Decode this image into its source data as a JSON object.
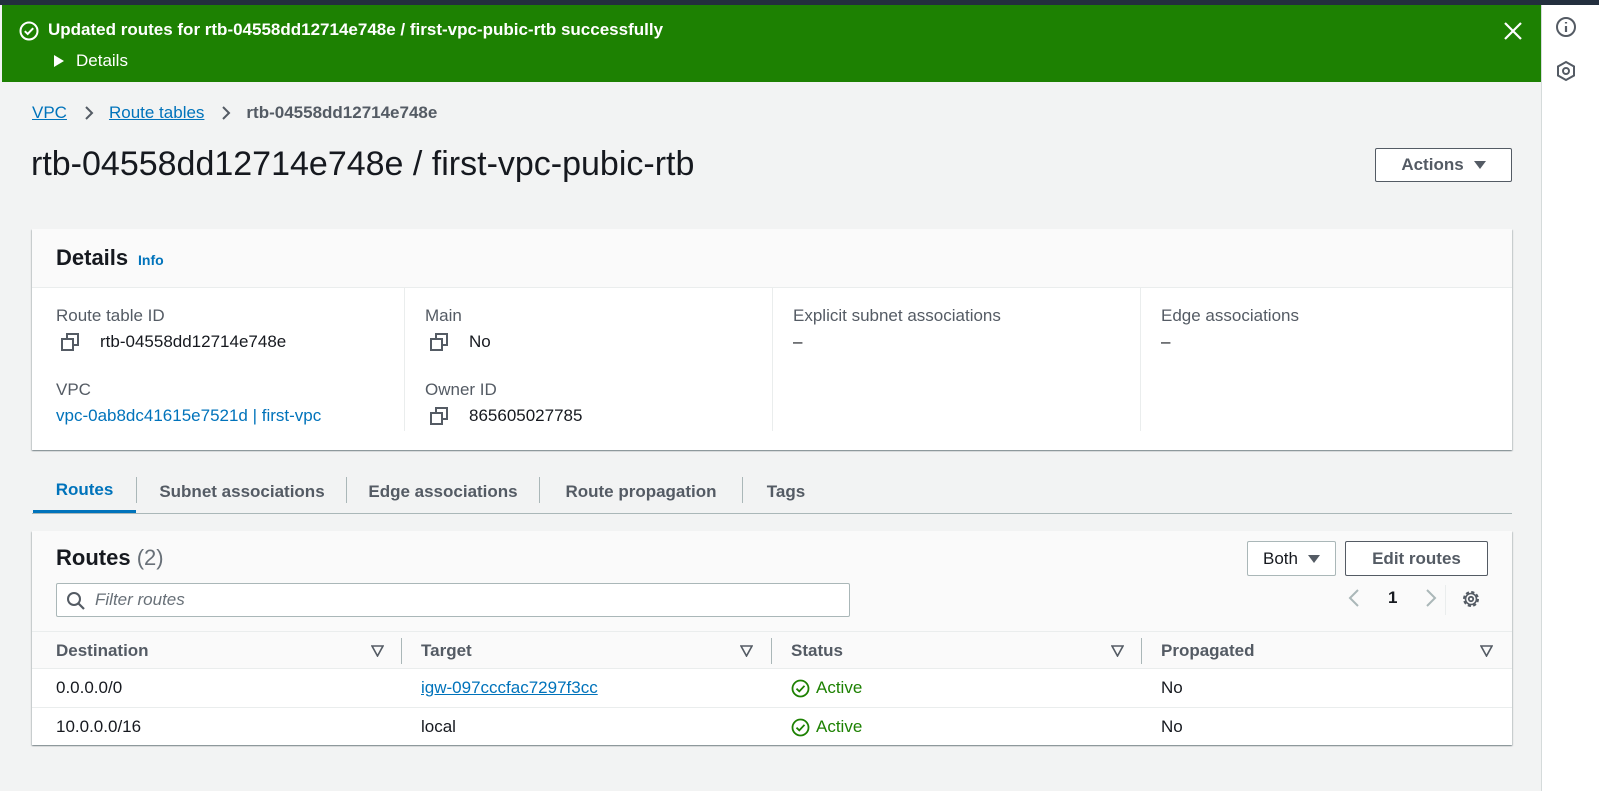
{
  "flash": {
    "message": "Updated routes for rtb-04558dd12714e748e / first-vpc-pubic-rtb successfully",
    "details_label": "Details",
    "color": "#1d8102"
  },
  "breadcrumb": {
    "items": [
      "VPC",
      "Route tables"
    ],
    "current": "rtb-04558dd12714e748e"
  },
  "page": {
    "title": "rtb-04558dd12714e748e / first-vpc-pubic-rtb",
    "actions_label": "Actions"
  },
  "details": {
    "title": "Details",
    "info_label": "Info",
    "route_table_id_label": "Route table ID",
    "route_table_id": "rtb-04558dd12714e748e",
    "main_label": "Main",
    "main": "No",
    "explicit_subnet_label": "Explicit subnet associations",
    "explicit_subnet": "–",
    "edge_assoc_label": "Edge associations",
    "edge_assoc": "–",
    "vpc_label": "VPC",
    "vpc": "vpc-0ab8dc41615e7521d | first-vpc",
    "owner_id_label": "Owner ID",
    "owner_id": "865605027785"
  },
  "tabs": [
    "Routes",
    "Subnet associations",
    "Edge associations",
    "Route propagation",
    "Tags"
  ],
  "active_tab": "Routes",
  "routes": {
    "title": "Routes",
    "count": "(2)",
    "filter_placeholder": "Filter routes",
    "filter_select": "Both",
    "edit_label": "Edit routes",
    "page": "1",
    "columns": [
      "Destination",
      "Target",
      "Status",
      "Propagated"
    ],
    "rows": [
      {
        "destination": "0.0.0.0/0",
        "target": "igw-097cccfac7297f3cc",
        "status": "Active",
        "propagated": "No"
      },
      {
        "destination": "10.0.0.0/16",
        "target": "local",
        "status": "Active",
        "propagated": "No"
      }
    ]
  },
  "colors": {
    "link": "#0073bb",
    "success": "#1d8102",
    "text": "#16191f",
    "secondary_text": "#545b64"
  }
}
